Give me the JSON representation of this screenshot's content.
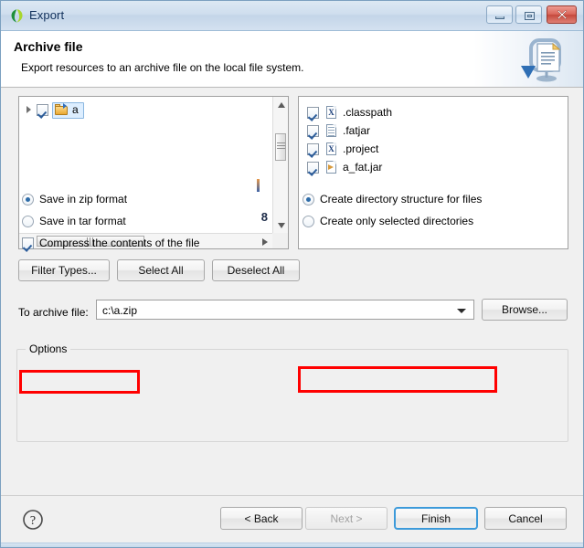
{
  "window": {
    "title": "Export",
    "app_icon": "eclipse-leaf-icon",
    "controls": {
      "minimize": "minimize-icon",
      "maximize": "maximize-icon",
      "close": "close-icon"
    }
  },
  "banner": {
    "title": "Archive file",
    "description": "Export resources to an archive file on the local file system.",
    "icon": "export-archive-icon"
  },
  "tree": {
    "root": {
      "label": "a",
      "checked": true,
      "expanded": false,
      "icon": "open-folder-icon",
      "selected": true
    },
    "partial_row_text": "",
    "artifact_number": "8"
  },
  "files": {
    "items": [
      {
        "name": ".classpath",
        "checked": true,
        "icon": "xml-file-icon"
      },
      {
        "name": ".fatjar",
        "checked": true,
        "icon": "text-file-icon"
      },
      {
        "name": ".project",
        "checked": true,
        "icon": "xml-file-icon"
      },
      {
        "name": "a_fat.jar",
        "checked": true,
        "icon": "jar-file-icon"
      }
    ]
  },
  "selection_buttons": {
    "filter_types": "Filter Types...",
    "select_all": "Select All",
    "deselect_all": "Deselect All"
  },
  "archive": {
    "label": "To archive file:",
    "value": "c:\\a.zip",
    "placeholder": "",
    "browse": "Browse...",
    "dropdown_icon": "chevron-down-icon"
  },
  "options": {
    "legend": "Options",
    "save_zip": {
      "label": "Save in zip format",
      "selected": true,
      "highlighted": true
    },
    "save_tar": {
      "label": "Save in tar format",
      "selected": false,
      "highlighted": false
    },
    "compress": {
      "label": "Compress the contents of the file",
      "checked": true
    },
    "create_dir_structure": {
      "label": "Create directory structure for files",
      "selected": true,
      "highlighted": true
    },
    "create_only_selected": {
      "label": "Create only selected directories",
      "selected": false,
      "highlighted": false
    },
    "highlight_color": "#ff0000"
  },
  "footer": {
    "help_icon": "help-question-icon",
    "back": "< Back",
    "next": "Next >",
    "next_disabled": true,
    "finish": "Finish",
    "finish_default": true,
    "cancel": "Cancel"
  },
  "colors": {
    "titlebar": "#cfdeee",
    "dialog_bg": "#f0f0f0",
    "accent": "#3c9ada",
    "highlight": "#ff0000",
    "selection": "#ddeeff"
  }
}
